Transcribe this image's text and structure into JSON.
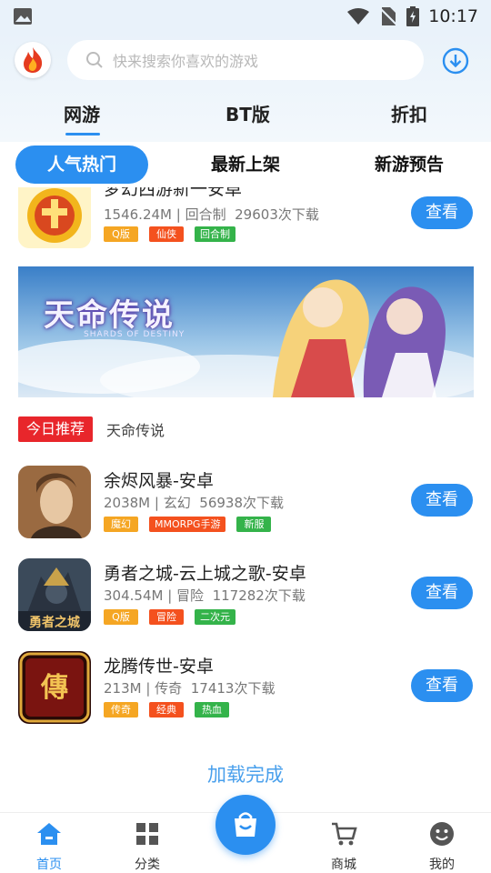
{
  "status_bar": {
    "time": "10:17"
  },
  "header": {
    "search_placeholder": "快来搜索你喜欢的游戏",
    "tabs": [
      {
        "label": "网游",
        "active": true
      },
      {
        "label": "BT版",
        "active": false
      },
      {
        "label": "折扣",
        "active": false
      }
    ]
  },
  "sub_tabs": [
    {
      "label": "人气热门",
      "active": true
    },
    {
      "label": "最新上架",
      "active": false
    },
    {
      "label": "新游预告",
      "active": false
    }
  ],
  "games": [
    {
      "title": "梦幻西游新一安卓",
      "size": "1546.24M",
      "genre": "回合制",
      "downloads": "29603次下载",
      "tags": [
        {
          "label": "Q版",
          "color": "#f5a623"
        },
        {
          "label": "仙侠",
          "color": "#f4511e"
        },
        {
          "label": "回合制",
          "color": "#34b34a"
        }
      ]
    },
    {
      "title": "余烬风暴-安卓",
      "size": "2038M",
      "genre": "玄幻",
      "downloads": "56938次下载",
      "tags": [
        {
          "label": "魔幻",
          "color": "#f5a623"
        },
        {
          "label": "MMORPG手游",
          "color": "#f4511e"
        },
        {
          "label": "新服",
          "color": "#34b34a"
        }
      ]
    },
    {
      "title": "勇者之城-云上城之歌-安卓",
      "size": "304.54M",
      "genre": "冒险",
      "downloads": "117282次下载",
      "tags": [
        {
          "label": "Q版",
          "color": "#f5a623"
        },
        {
          "label": "冒险",
          "color": "#f4511e"
        },
        {
          "label": "二次元",
          "color": "#34b34a"
        }
      ]
    },
    {
      "title": "龙腾传世-安卓",
      "size": "213M",
      "genre": "传奇",
      "downloads": "17413次下载",
      "tags": [
        {
          "label": "传奇",
          "color": "#f5a623"
        },
        {
          "label": "经典",
          "color": "#f4511e"
        },
        {
          "label": "热血",
          "color": "#34b34a"
        }
      ]
    }
  ],
  "view_button_label": "查看",
  "banner": {
    "title": "天命传说",
    "subtitle": "SHARDS OF DESTINY"
  },
  "today_pick": {
    "badge": "今日推荐",
    "game": "天命传说"
  },
  "load_status": "加载完成",
  "bottom_nav": [
    {
      "label": "首页",
      "icon": "home-icon",
      "active": true
    },
    {
      "label": "分类",
      "icon": "grid-icon",
      "active": false
    },
    {
      "label": "商城",
      "icon": "cart-icon",
      "active": false
    },
    {
      "label": "我的",
      "icon": "smiley-icon",
      "active": false
    }
  ],
  "colors": {
    "accent": "#2b8ff0",
    "badge_red": "#e8262b"
  }
}
